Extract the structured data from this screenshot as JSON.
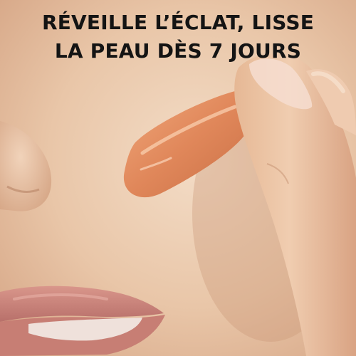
{
  "headline": {
    "line1": "RÉVEILLE L’ÉCLAT, LISSE",
    "line2": "LA PEAU DÈS 7 JOURS"
  },
  "colors": {
    "skin_light": "#f1d6bf",
    "skin_mid": "#e4bb9a",
    "skin_shadow": "#c99a7a",
    "serum": "#e08a5c",
    "lips": "#c9857c",
    "text": "#141414"
  }
}
